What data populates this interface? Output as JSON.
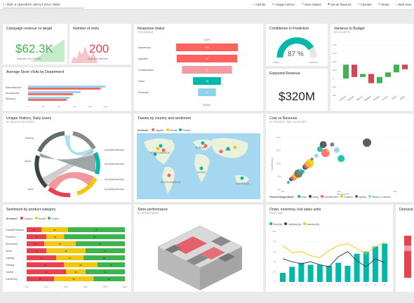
{
  "topbar": {
    "question": "Ask a question about your data",
    "actions": [
      "Add tile",
      "Usage metrics",
      "View related",
      "Set as featured",
      "Favorite",
      "Share",
      "Web view"
    ]
  },
  "colors": {
    "green": "#3fb34f",
    "red": "#e8414f",
    "teal": "#01b8aa",
    "gray": "#5f6b6d",
    "yellow": "#f2c80f",
    "salmon": "#fd625e",
    "pink": "#d64550"
  },
  "tiles": {
    "campaign": {
      "title": "Campaign revenue vs target",
      "value": "$62.3K",
      "goal": "Goal: $22.7K (+174.6%)"
    },
    "visits": {
      "title": "Number of visits",
      "value": "200",
      "goal": "Goal: 446 (-55.06%)"
    },
    "response": {
      "title": "Response status",
      "subtitle": "THOUSANDS",
      "top": "100%",
      "bottom": "16.92%"
    },
    "confidence": {
      "title": "Confidence in Prediction",
      "value": "87 %",
      "min": "0.00 %",
      "max": "100.00 %"
    },
    "variance": {
      "title": "Variance to Budget",
      "subtitle": "BY COUNTRY"
    },
    "store_visits": {
      "title": "Average Store Visits by Department"
    },
    "expected": {
      "title": "Expected Revenue",
      "value": "$320M"
    },
    "unique": {
      "title": "Unique Visitors, Daily Users",
      "subtitle": "BY DEVICE CATEGORY"
    },
    "tweets": {
      "title": "Tweets by country and sentiment"
    },
    "cost": {
      "title": "Cost vs Revenue",
      "subtitle": "BY PRODUCT AND CATEGORY"
    },
    "sentiment": {
      "title": "Sentiment by product category"
    },
    "store": {
      "title": "Store performance",
      "subtitle": "BY DEPARTMENT"
    },
    "order": {
      "title": "Order, inventory, lost sales units",
      "subtitle": "OVER TIME"
    },
    "demand": {
      "title": "Demand"
    }
  },
  "response_chart": {
    "type": "bar",
    "categories": [
      "Awareness",
      "Inquiries",
      "Consideration",
      "Intent",
      "Purchase"
    ],
    "values": [
      100,
      98,
      81,
      45,
      29
    ]
  },
  "store_visits_chart": {
    "type": "bar",
    "categories": [
      "Entertainment",
      "Accessories",
      "Womens"
    ],
    "series": [
      {
        "values": [
          100,
          68,
          54
        ]
      },
      {
        "values": [
          94,
          58,
          50
        ]
      }
    ],
    "xticks": [
      "0",
      "20",
      "40",
      "60",
      "80",
      "100"
    ]
  },
  "variance_chart": {
    "type": "bar",
    "categories": [
      "Norway",
      "Sweden",
      "Mexico",
      "Belgium",
      "Estonia",
      "France",
      "Brazil",
      "Spain"
    ],
    "values": [
      9,
      -8,
      2,
      -6,
      4,
      3,
      5,
      -3
    ],
    "yticks": [
      "+700",
      "+400",
      "+200",
      "+100",
      "0",
      "-100",
      "-200"
    ]
  },
  "tweets_legend": {
    "label": "Sentiment",
    "items": [
      "Negative",
      "Neutral",
      "Positive"
    ]
  },
  "map_labels": [
    "NORTH AMERICA",
    "EUROPE",
    "ASIA",
    "AFRICA",
    "SOUTH AMERICA",
    "AUSTRALIA"
  ],
  "unique_labels": [
    "Desktop",
    "Mobile",
    "Tablet",
    "Num(WebsiteVisits)",
    "Num(WebsiteVisits)",
    "Num(WebsiteVisits)",
    "Num(WebsiteVisits)"
  ],
  "cost_chart": {
    "type": "scatter",
    "xlabel": "RevenueR%",
    "ylabel": "Cost%Dollars",
    "legend_label": "ProductCategoryName",
    "legend": [
      "Doors",
      "Dining",
      "Entertainment",
      "Furniture",
      "Lighting",
      "Pillows & Cushions"
    ],
    "yticks": [
      "20%",
      "15%",
      "10%",
      "5%",
      "0%"
    ],
    "xticks": [
      "0%",
      "10%",
      "20%"
    ],
    "points": [
      {
        "x": 1,
        "y": 1.5
      },
      {
        "x": 1.5,
        "y": 2.2
      },
      {
        "x": 2,
        "y": 2.5
      },
      {
        "x": 2.4,
        "y": 3
      },
      {
        "x": 2.8,
        "y": 3.4
      },
      {
        "x": 3.2,
        "y": 4.2
      },
      {
        "x": 3.5,
        "y": 3.8
      },
      {
        "x": 4,
        "y": 4.8
      },
      {
        "x": 4.4,
        "y": 5.2
      },
      {
        "x": 4.8,
        "y": 5.6
      },
      {
        "x": 5.2,
        "y": 6.5
      },
      {
        "x": 6,
        "y": 7.2
      },
      {
        "x": 6.6,
        "y": 8.6
      },
      {
        "x": 7.2,
        "y": 9.6
      },
      {
        "x": 7.6,
        "y": 7.8
      },
      {
        "x": 8,
        "y": 8.2
      },
      {
        "x": 8.8,
        "y": 9.6
      },
      {
        "x": 9.6,
        "y": 8.4
      },
      {
        "x": 10.4,
        "y": 6.6
      },
      {
        "x": 15,
        "y": 10
      }
    ]
  },
  "sentiment_chart": {
    "type": "bar",
    "legend_label": "Sentiment",
    "legend": [
      "Negative",
      "Neutral",
      "Positive"
    ],
    "categories": [
      "Cocktail Glasses",
      "Furniture",
      "Electronics",
      "Décor",
      "Lighting",
      "Gaming",
      "Games",
      "Gardening"
    ],
    "series": [
      {
        "name": "Negative",
        "values": [
          15,
          20,
          18,
          20,
          30,
          38,
          40,
          28
        ]
      },
      {
        "name": "Neutral",
        "values": [
          27,
          18,
          32,
          40,
          28,
          34,
          20,
          40
        ]
      },
      {
        "name": "Positive",
        "values": [
          58,
          62,
          50,
          40,
          42,
          28,
          40,
          32
        ]
      }
    ],
    "labels": [
      [
        "$3",
        "$5",
        "$7"
      ],
      [
        "$5",
        "$4",
        "$8"
      ],
      [
        "$5",
        "$6",
        "$7"
      ],
      [
        "$5",
        "$5",
        "$5"
      ],
      [
        "$5",
        "$4",
        "$6"
      ],
      [
        "$6",
        "$5",
        "$3"
      ],
      [
        "$6",
        "$3",
        "$4"
      ],
      [
        "$4",
        "$5",
        "$3"
      ]
    ],
    "xticks": [
      "0%",
      "20%",
      "40%",
      "60%",
      "80%",
      "100%"
    ]
  },
  "order_chart": {
    "type": "bar",
    "legend": [
      "OrderQty",
      "LostSalesQty",
      "InventoryQty"
    ],
    "categories": [
      "1",
      "2",
      "3",
      "4",
      "5",
      "6",
      "7",
      "8",
      "9",
      "10",
      "11",
      "12"
    ],
    "bars": [
      18,
      30,
      38,
      34,
      34,
      32,
      38,
      32,
      56,
      60,
      70,
      76
    ],
    "line1": [
      72,
      58,
      60,
      52,
      48,
      62,
      72,
      76,
      66,
      56,
      70,
      78
    ],
    "line2": [
      46,
      40,
      36,
      40,
      34,
      30,
      50,
      60,
      42,
      30,
      46,
      38
    ],
    "yticks": [
      "100",
      "80",
      "60",
      "40",
      "20",
      "0"
    ]
  }
}
